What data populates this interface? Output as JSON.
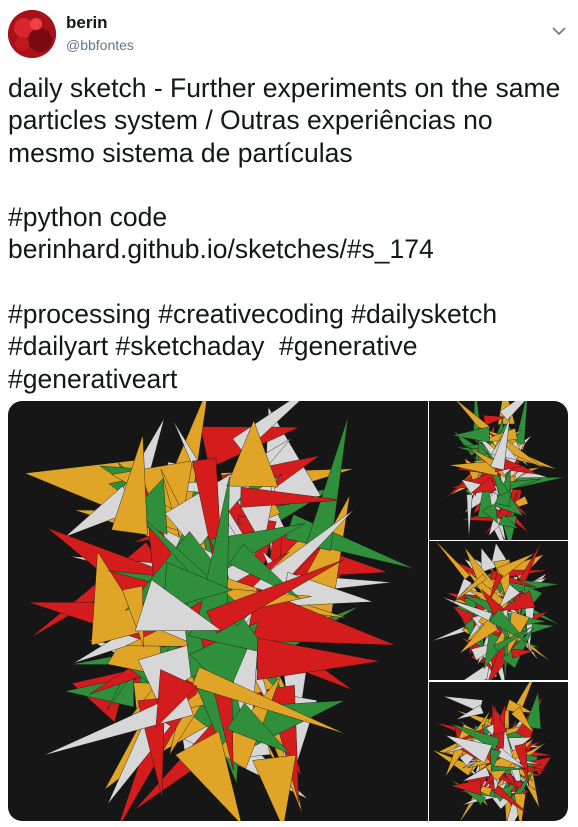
{
  "user": {
    "name": "berin",
    "handle": "@bbfontes",
    "avatar_icon": "avatar-image",
    "menu_icon": "chevron-down-icon"
  },
  "tweet": {
    "text": "daily sketch - Further experiments on the same particles system / Outras experiências no mesmo sistema de partículas\n\n#python code berinhard.github.io/sketches/#s_174\n\n#processing #creativecoding #dailysketch #dailyart #sketchaday  #generative #generativeart"
  },
  "media": {
    "count": 4,
    "palette": [
      "#d41c1c",
      "#2f8f3a",
      "#e0a526",
      "#d7d7d7",
      "#161616"
    ]
  }
}
